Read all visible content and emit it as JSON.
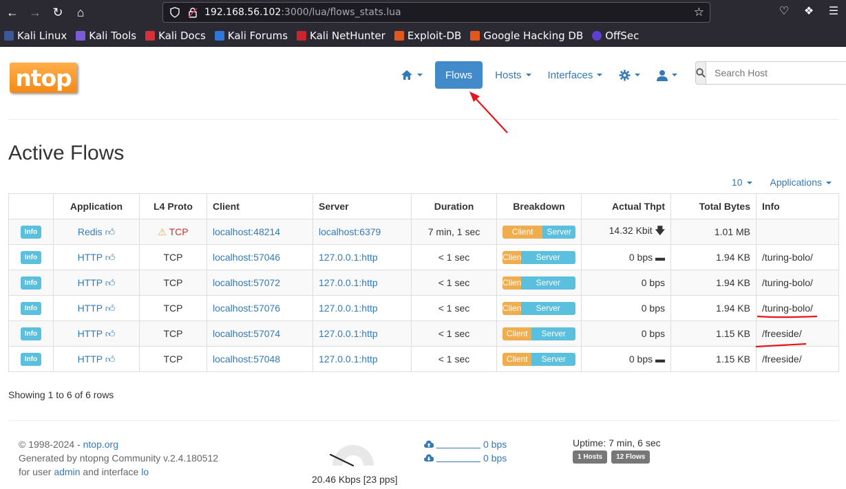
{
  "browser": {
    "url_host": "192.168.56.102",
    "url_path": ":3000/lua/flows_stats.lua",
    "bookmarks": [
      "Kali Linux",
      "Kali Tools",
      "Kali Docs",
      "Kali Forums",
      "Kali NetHunter",
      "Exploit-DB",
      "Google Hacking DB",
      "OffSec"
    ]
  },
  "logo": "ntop",
  "nav": {
    "flows": "Flows",
    "hosts": "Hosts",
    "interfaces": "Interfaces",
    "search_placeholder": "Search Host"
  },
  "page_title": "Active Flows",
  "controls": {
    "per_page": "10",
    "applications": "Applications"
  },
  "table": {
    "headers": [
      "",
      "Application",
      "L4 Proto",
      "Client",
      "Server",
      "Duration",
      "Breakdown",
      "Actual Thpt",
      "Total Bytes",
      "Info"
    ],
    "info_label": "Info",
    "rows": [
      {
        "app": "Redis",
        "proto": "TCP",
        "proto_warn": true,
        "client_host": "localhost",
        "client_port": ":48214",
        "server_host": "localhost",
        "server_port": ":6379",
        "duration": "7 min, 1 sec",
        "client_pct": 55,
        "client_label": "Client",
        "server_label": "Server",
        "thpt": "14.32 Kbit",
        "trend": "down",
        "bytes": "1.01 MB",
        "info": ""
      },
      {
        "app": "HTTP",
        "proto": "TCP",
        "proto_warn": false,
        "client_host": "localhost",
        "client_port": ":57046",
        "server_host": "127.0.0.1",
        "server_port": ":http",
        "duration": "< 1 sec",
        "client_pct": 25,
        "client_label": "Clien",
        "server_label": "Server",
        "thpt": "0 bps",
        "trend": "flat",
        "bytes": "1.94 KB",
        "info": "/turing-bolo/"
      },
      {
        "app": "HTTP",
        "proto": "TCP",
        "proto_warn": false,
        "client_host": "localhost",
        "client_port": ":57072",
        "server_host": "127.0.0.1",
        "server_port": ":http",
        "duration": "< 1 sec",
        "client_pct": 25,
        "client_label": "Clien",
        "server_label": "Server",
        "thpt": "0 bps",
        "trend": "",
        "bytes": "1.94 KB",
        "info": "/turing-bolo/"
      },
      {
        "app": "HTTP",
        "proto": "TCP",
        "proto_warn": false,
        "client_host": "localhost",
        "client_port": ":57076",
        "server_host": "127.0.0.1",
        "server_port": ":http",
        "duration": "< 1 sec",
        "client_pct": 25,
        "client_label": "Clien",
        "server_label": "Server",
        "thpt": "0 bps",
        "trend": "",
        "bytes": "1.94 KB",
        "info": "/turing-bolo/"
      },
      {
        "app": "HTTP",
        "proto": "TCP",
        "proto_warn": false,
        "client_host": "localhost",
        "client_port": ":57074",
        "server_host": "127.0.0.1",
        "server_port": ":http",
        "duration": "< 1 sec",
        "client_pct": 40,
        "client_label": "Client",
        "server_label": "Server",
        "thpt": "0 bps",
        "trend": "",
        "bytes": "1.15 KB",
        "info": "/freeside/"
      },
      {
        "app": "HTTP",
        "proto": "TCP",
        "proto_warn": false,
        "client_host": "localhost",
        "client_port": ":57048",
        "server_host": "127.0.0.1",
        "server_port": ":http",
        "duration": "< 1 sec",
        "client_pct": 40,
        "client_label": "Client",
        "server_label": "Server",
        "thpt": "0 bps",
        "trend": "flat",
        "bytes": "1.15 KB",
        "info": "/freeside/"
      }
    ]
  },
  "showing": "Showing 1 to 6 of 6 rows",
  "footer": {
    "copyright_prefix": "© 1998-2024 - ",
    "copyright_link": "ntop.org",
    "generated": "Generated by ntopng Community v.2.4.180512",
    "user_prefix": "for user ",
    "user": "admin",
    "iface_prefix": " and interface ",
    "iface": "lo",
    "gauge_label": "20.46 Kbps [23 pps]",
    "upload": "0 bps",
    "download": "0 bps",
    "uptime": "Uptime: 7 min, 6 sec",
    "hosts_badge": "1 Hosts",
    "flows_badge": "12 Flows"
  },
  "colors": {
    "accent": "#337ab7",
    "active_nav": "#428bca",
    "client_bar": "#f0ad4e",
    "server_bar": "#5bc0de",
    "annotation": "#e8141b"
  }
}
